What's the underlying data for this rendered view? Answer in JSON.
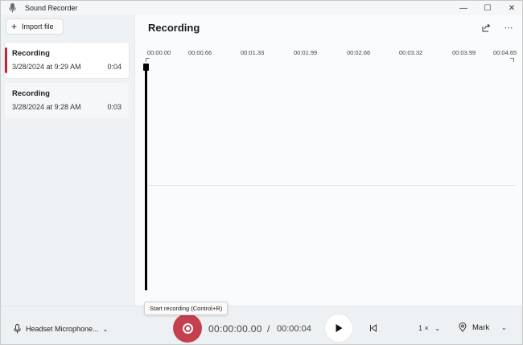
{
  "window": {
    "title": "Sound Recorder",
    "controls": {
      "minimize": "—",
      "maximize": "☐",
      "close": "✕"
    }
  },
  "sidebar": {
    "import_label": "Import file",
    "recordings": [
      {
        "name": "Recording",
        "date": "3/28/2024 at 9:29 AM",
        "duration": "0:04",
        "selected": true
      },
      {
        "name": "Recording",
        "date": "3/28/2024 at 9:28 AM",
        "duration": "0:03",
        "selected": false
      }
    ]
  },
  "main": {
    "title": "Recording",
    "timeline_ticks": [
      "00:00.00",
      "00:00.66",
      "00:01.33",
      "00:01.99",
      "00:02.66",
      "00:03.32",
      "00:03.99",
      "00:04.65"
    ],
    "actions": {
      "share_icon": "share-icon",
      "more_icon": "more-icon"
    }
  },
  "bottom": {
    "microphone": "Headset Microphone...",
    "current_time": "00:00:00.00",
    "separator": "/",
    "total_time": "00:00:04",
    "speed": "1 ×",
    "mark_label": "Mark",
    "tooltip": "Start recording (Control+R)"
  },
  "colors": {
    "accent_red": "#c4404f",
    "selection_bar": "#c4243c"
  }
}
